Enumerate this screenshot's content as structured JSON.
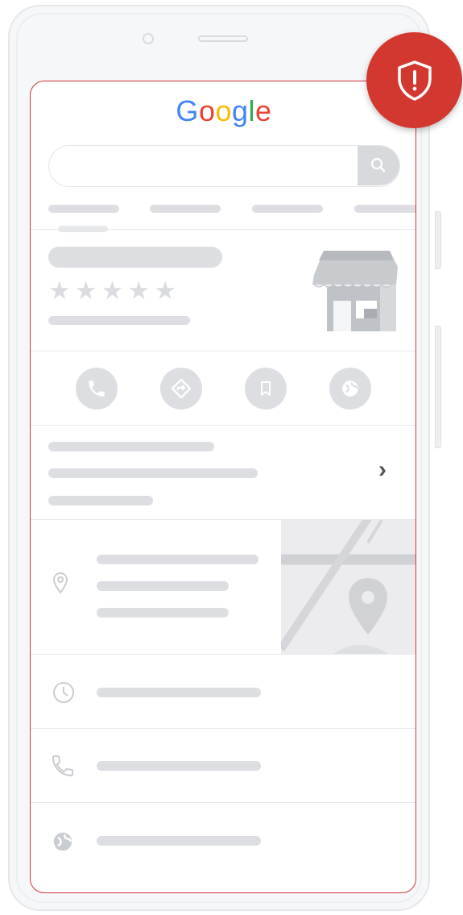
{
  "logo": {
    "text": "Google",
    "letters": [
      "G",
      "o",
      "o",
      "g",
      "l",
      "e"
    ],
    "colors": [
      "#4285F4",
      "#EA4335",
      "#FBBC05",
      "#4285F4",
      "#34A853",
      "#EA4335"
    ]
  },
  "search": {
    "icon": "search-icon"
  },
  "business_card": {
    "rating_stars": [
      "★",
      "★",
      "★",
      "★",
      "★"
    ],
    "image_icon": "storefront-icon"
  },
  "actions": [
    {
      "name": "call",
      "icon": "phone-icon"
    },
    {
      "name": "directions",
      "icon": "directions-icon"
    },
    {
      "name": "save",
      "icon": "bookmark-icon"
    },
    {
      "name": "website",
      "icon": "globe-icon"
    }
  ],
  "details": {
    "chevron": "›"
  },
  "info_rows": [
    {
      "name": "address",
      "icon": "location-pin-icon"
    },
    {
      "name": "hours",
      "icon": "clock-icon"
    },
    {
      "name": "phone",
      "icon": "phone-icon"
    },
    {
      "name": "website",
      "icon": "globe-icon"
    }
  ],
  "badge": {
    "icon": "shield-alert-icon",
    "symbol": "!",
    "color": "#d33830"
  },
  "colors": {
    "screen_border": "#d2343b",
    "placeholder": "#dcdee1"
  }
}
